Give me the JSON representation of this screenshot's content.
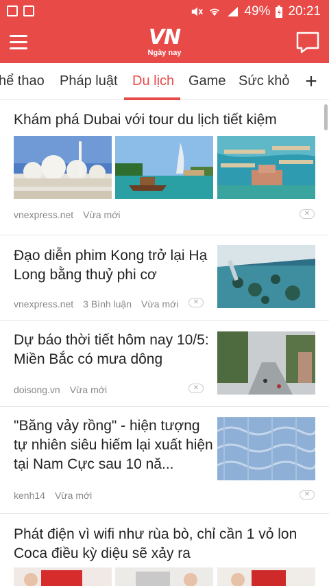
{
  "status": {
    "battery": "49%",
    "time": "20:21"
  },
  "app": {
    "logo_main": "VN",
    "logo_sub": "Ngày nay"
  },
  "tabs": [
    {
      "label": "hể thao"
    },
    {
      "label": "Pháp luật"
    },
    {
      "label": "Du lịch"
    },
    {
      "label": "Game"
    },
    {
      "label": "Sức khỏ"
    }
  ],
  "add_tab": "+",
  "articles": [
    {
      "title": "Khám phá Dubai với tour du lịch tiết kiệm",
      "source": "vnexpress.net",
      "comments": "",
      "time": "Vừa mới",
      "images": [
        "mosque-image",
        "burj-al-arab-image",
        "palm-island-image"
      ]
    },
    {
      "title": "Đạo diễn phim Kong trở lại Hạ Long bằng thuỷ phi cơ",
      "source": "vnexpress.net",
      "comments": "3 Bình luận",
      "time": "Vừa mới",
      "images": [
        "seaplane-halong-image"
      ]
    },
    {
      "title": "Dự báo thời tiết hôm nay 10/5: Miền Bắc có mưa dông",
      "source": "doisong.vn",
      "comments": "",
      "time": "Vừa mới",
      "images": [
        "rainy-street-image"
      ]
    },
    {
      "title": "\"Băng vảy rồng\" - hiện tượng tự nhiên siêu hiếm lại xuất hiện tại Nam Cực sau 10 nă...",
      "source": "kenh14",
      "comments": "",
      "time": "Vừa mới",
      "images": [
        "dragon-scale-ice-image"
      ]
    },
    {
      "title": "Phát điện vì wifi như rùa bò, chỉ cần 1 vỏ lon Coca điều kỳ diệu sẽ xảy ra",
      "source": "",
      "comments": "",
      "time": "",
      "images": [
        "coca-can-image-1",
        "coca-can-image-2",
        "coca-can-image-3"
      ]
    }
  ],
  "close_symbol": "✕",
  "colors": {
    "accent": "#e84a48"
  }
}
